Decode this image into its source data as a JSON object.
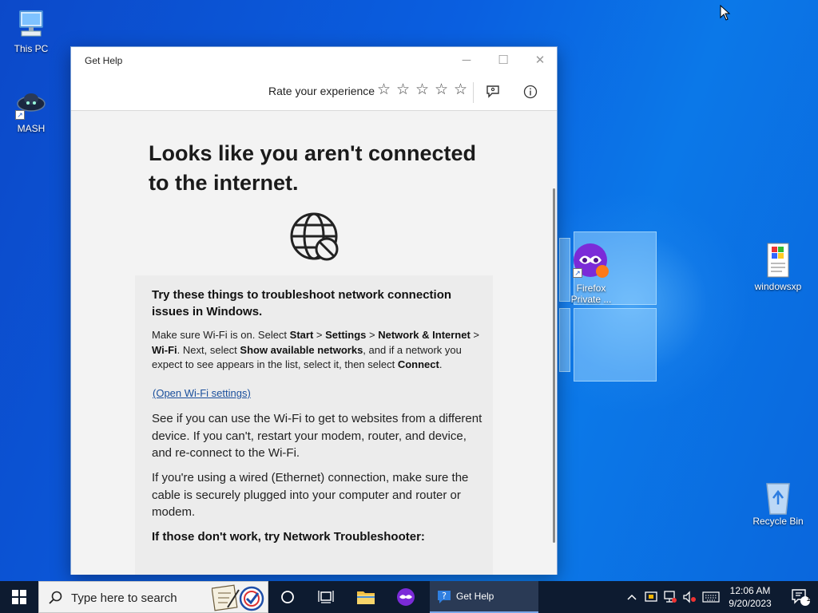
{
  "desktop": {
    "icons": [
      {
        "label": "This PC"
      },
      {
        "label": "MASH"
      },
      {
        "label": "Firefox Private ..."
      },
      {
        "label": "windowsxp"
      },
      {
        "label": "Recycle Bin"
      }
    ]
  },
  "window": {
    "title": "Get Help",
    "controls": {
      "minimize": "─",
      "maximize": "☐",
      "close": "✕"
    },
    "toolbar": {
      "rate_label": "Rate your experience",
      "stars": [
        "☆",
        "☆",
        "☆",
        "☆",
        "☆"
      ],
      "icons": [
        "feedback-icon",
        "info-icon"
      ]
    },
    "content": {
      "headline": "Looks like you aren't connected to the internet.",
      "icon": "globe-blocked-icon",
      "card": {
        "heading": "Try these things to troubleshoot network connection issues in Windows.",
        "wifi_tip": {
          "t1": "Make sure Wi-Fi is on. Select ",
          "b1": "Start",
          "t2": " > ",
          "b2": "Settings",
          "t3": " > ",
          "b3": "Network & Internet",
          "t4": " > ",
          "b4": "Wi-Fi",
          "t5": ". Next, select ",
          "b5": "Show available networks",
          "t6": ", and if a network you expect to see appears in the list, select it, then select ",
          "b6": "Connect",
          "t7": "."
        },
        "link": "(Open Wi-Fi settings)",
        "para2": "See if you can use the Wi-Fi to get to websites from a different device. If you can't, restart your modem, router, and device, and re-connect to the Wi-Fi.",
        "para3": "If you're using a wired (Ethernet) connection, make sure the cable is securely plugged into your computer and router or modem.",
        "para4": "If those don't work, try Network Troubleshooter:"
      }
    }
  },
  "taskbar": {
    "search_placeholder": "Type here to search",
    "active_app": "Get Help",
    "tray_icons": [
      "chevron-up-icon",
      "network-settings-icon",
      "network-disconnected-icon",
      "volume-muted-icon",
      "keyboard-icon"
    ],
    "clock": {
      "time": "12:06 AM",
      "date": "9/20/2023"
    },
    "notification_count": "1"
  }
}
